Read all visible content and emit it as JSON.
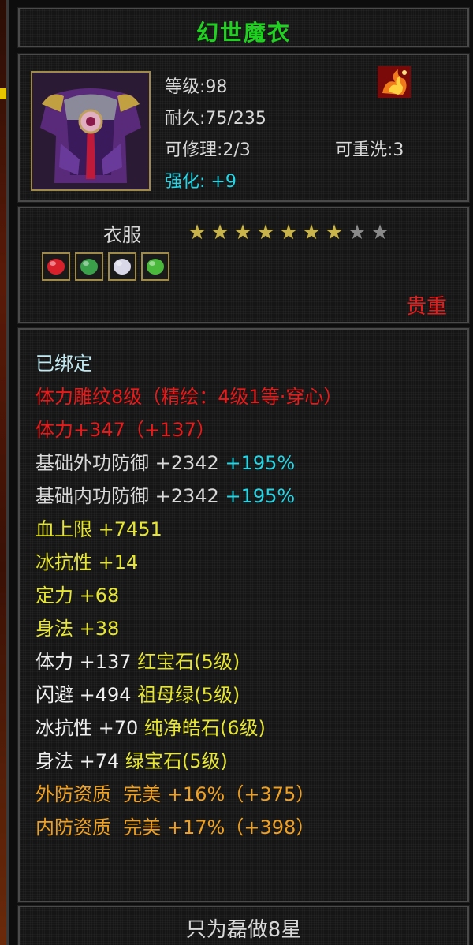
{
  "item": {
    "name": "幻世魔衣",
    "level": "等级:98",
    "durability": "耐久:75/235",
    "repair": "可修理:2/3",
    "rewash": "可重洗:3",
    "enhance_label": "强化:",
    "enhance_value": "+9",
    "category": "衣服",
    "stars_filled": 7,
    "stars_total": 9,
    "rarity": "贵重",
    "footer": "只为磊做8星"
  },
  "gems": [
    {
      "icon": "red-gem-icon",
      "color": "#d8202a"
    },
    {
      "icon": "green-jade-icon",
      "color": "#3aa04a"
    },
    {
      "icon": "white-crystal-icon",
      "color": "#d8d8e8"
    },
    {
      "icon": "green-stone-icon",
      "color": "#4ab83a"
    }
  ],
  "properties": [
    {
      "text": "已绑定",
      "color": "#bfe8f0",
      "segments": [
        {
          "text": "已绑定",
          "color": "#bfe8f0"
        }
      ]
    },
    {
      "segments": [
        {
          "text": "体力雕纹8级（精绘：4级1等·穿心）",
          "color": "#e81a1a"
        }
      ]
    },
    {
      "segments": [
        {
          "text": "体力+347（+137）",
          "color": "#e81a1a"
        }
      ]
    },
    {
      "segments": [
        {
          "text": "基础外功防御 +2342 ",
          "color": "#d8d8d8"
        },
        {
          "text": "+195%",
          "color": "#24d6e6"
        }
      ]
    },
    {
      "segments": [
        {
          "text": "基础内功防御 +2342 ",
          "color": "#d8d8d8"
        },
        {
          "text": "+195%",
          "color": "#24d6e6"
        }
      ]
    },
    {
      "segments": [
        {
          "text": "血上限 +7451",
          "color": "#e6e632"
        }
      ]
    },
    {
      "segments": [
        {
          "text": "冰抗性 +14",
          "color": "#e6e632"
        }
      ]
    },
    {
      "segments": [
        {
          "text": "定力 +68",
          "color": "#e6e632"
        }
      ]
    },
    {
      "segments": [
        {
          "text": "身法 +38",
          "color": "#e6e632"
        }
      ]
    },
    {
      "segments": [
        {
          "text": "体力 +137 ",
          "color": "#f0f0f0"
        },
        {
          "text": "红宝石(5级)",
          "color": "#e6e632"
        }
      ]
    },
    {
      "segments": [
        {
          "text": "闪避 +494 ",
          "color": "#f0f0f0"
        },
        {
          "text": "祖母绿(5级)",
          "color": "#e6e632"
        }
      ]
    },
    {
      "segments": [
        {
          "text": "冰抗性 +70 ",
          "color": "#f0f0f0"
        },
        {
          "text": "纯净皓石(6级)",
          "color": "#e6e632"
        }
      ]
    },
    {
      "segments": [
        {
          "text": "身法 +74 ",
          "color": "#f0f0f0"
        },
        {
          "text": "绿宝石(5级)",
          "color": "#e6e632"
        }
      ]
    },
    {
      "segments": [
        {
          "text": "外防资质  完美 +16%（+375）",
          "color": "#f0a020"
        }
      ]
    },
    {
      "segments": [
        {
          "text": "内防资质  完美 +17%（+398）",
          "color": "#f0a020"
        }
      ]
    }
  ]
}
